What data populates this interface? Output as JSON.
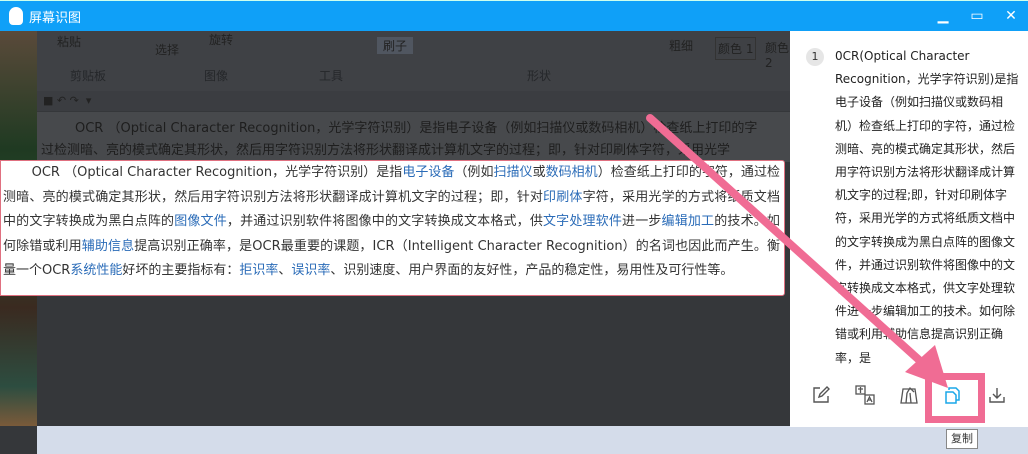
{
  "window": {
    "title": "屏幕识图",
    "controls": [
      "minimize",
      "maximize",
      "close"
    ]
  },
  "background_app": {
    "ribbon_tops": [
      "粘贴",
      "选择",
      "旋转",
      "刷子",
      "粗细",
      "颜色 1",
      "颜色 2"
    ],
    "ribbon_groups": [
      "剪贴板",
      "图像",
      "工具",
      "形状"
    ],
    "doc_line1": "OCR （Optical Character Recognition，光学字符识别）是指电子设备（例如扫描仪或数码相机）检查纸上打印的字",
    "doc_line2": "过检测暗、亮的模式确定其形状，然后用字符识别方法将形状翻译成计算机文字的过程；即，针对印刷体字符，采用光学"
  },
  "selection": {
    "segments": [
      {
        "t": "OCR （Optical Character Recognition，光学字符识别）是指"
      },
      {
        "t": "电子设备",
        "link": true
      },
      {
        "t": "（例如"
      },
      {
        "t": "扫描仪",
        "link": true
      },
      {
        "t": "或"
      },
      {
        "t": "数码相机",
        "link": true
      },
      {
        "t": "）检查纸上打印的字符，通过检测暗、亮的模式确定其形状，然后用字符识别方法将形状翻译成计算机文字的过程；即，针对"
      },
      {
        "t": "印刷体",
        "link": true
      },
      {
        "t": "字符，采用光学的方式将纸质文档中的文字转换成为黑白点阵的"
      },
      {
        "t": "图像文件",
        "link": true
      },
      {
        "t": "，并通过识别软件将图像中的文字转换成文本格式，供"
      },
      {
        "t": "文字处理软件",
        "link": true
      },
      {
        "t": "进一步"
      },
      {
        "t": "编辑加工",
        "link": true
      },
      {
        "t": "的技术。如何除错或利用"
      },
      {
        "t": "辅助信息",
        "link": true
      },
      {
        "t": "提高识别正确率，是OCR最重要的课题，ICR（Intelligent Character Recognition）的名词也因此而产生。衡量一个OCR"
      },
      {
        "t": "系统性能",
        "link": true
      },
      {
        "t": "好坏的主要指标有："
      },
      {
        "t": "拒识率",
        "link": true
      },
      {
        "t": "、"
      },
      {
        "t": "误识率",
        "link": true
      },
      {
        "t": "、识别速度、用户界面的友好性，产品的稳定性，易用性及可行性等。"
      }
    ]
  },
  "result_panel": {
    "index": "1",
    "text": "0CR(Optical Character Recognition，光学字符识别)是指电子设备（例如扫描仪或数码相机）检查纸上打印的字符，通过检测暗、亮的模式确定其形状，然后用字符识别方法将形状翻译成计算机文字的过程;即，针对印刷体字符，采用光学的方式将纸质文档中的文字转换成为黑白点阵的图像文件，并通过识别软件将图像中的文字转换成文本格式，供文字处理软件进一步编辑加工的技术。如何除错或利用辅助信息提高识别正确率，是",
    "toolbar": [
      "edit-icon",
      "translate-icon",
      "export-icon",
      "copy-icon",
      "download-icon"
    ],
    "tooltip": "复制"
  },
  "colors": {
    "titlebar": "#0fa0f8",
    "highlight": "#f06c94",
    "link": "#2b6cb8",
    "copy_icon": "#1aa7e8"
  }
}
